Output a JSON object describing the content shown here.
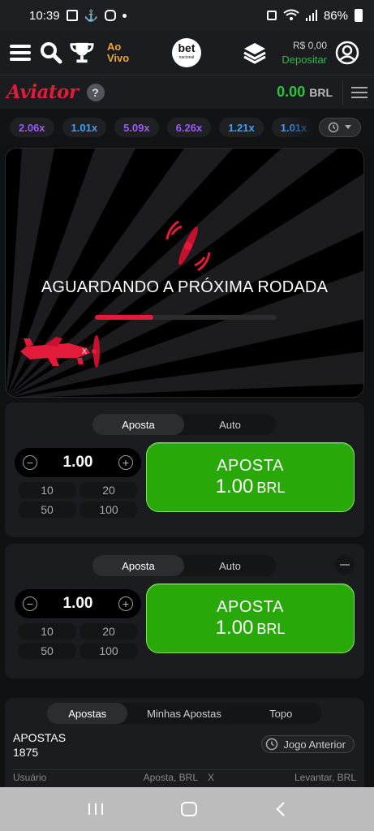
{
  "statusbar": {
    "time": "10:39",
    "battery": "86%"
  },
  "topnav": {
    "live_line1": "Ao",
    "live_line2": "Vivo",
    "logo_text": "bet",
    "logo_sub": "nacional",
    "balance": "R$ 0,00",
    "deposit": "Depositar"
  },
  "game_header": {
    "logo": "Aviator",
    "help": "?",
    "amount": "0.00",
    "currency": "BRL"
  },
  "multipliers": [
    {
      "value": "2.06x",
      "color": "#9b59ff"
    },
    {
      "value": "1.01x",
      "color": "#3aa0ff"
    },
    {
      "value": "5.09x",
      "color": "#9b59ff"
    },
    {
      "value": "6.26x",
      "color": "#9b59ff"
    },
    {
      "value": "1.21x",
      "color": "#3aa0ff"
    },
    {
      "value": "1.01x",
      "color": "#3aa0ff"
    }
  ],
  "game": {
    "waiting_text": "AGUARDANDO A PRÓXIMA RODADA",
    "progress": 0.32,
    "accent": "#e31b3a"
  },
  "bet_panel_1": {
    "tabs": [
      "Aposta",
      "Auto"
    ],
    "stake": "1.00",
    "quick": [
      "10",
      "20",
      "50",
      "100"
    ],
    "button_line1": "APOSTA",
    "button_amount": "1.00",
    "button_currency": "BRL"
  },
  "bet_panel_2": {
    "tabs": [
      "Aposta",
      "Auto"
    ],
    "stake": "1.00",
    "quick": [
      "10",
      "20",
      "50",
      "100"
    ],
    "button_line1": "APOSTA",
    "button_amount": "1.00",
    "button_currency": "BRL"
  },
  "bets": {
    "tabs": [
      "Apostas",
      "Minhas Apostas",
      "Topo"
    ],
    "title": "APOSTAS",
    "count": "1875",
    "previous_button": "Jogo Anterior",
    "columns": [
      "Usuário",
      "Aposta, BRL",
      "X",
      "Levantar, BRL"
    ]
  }
}
